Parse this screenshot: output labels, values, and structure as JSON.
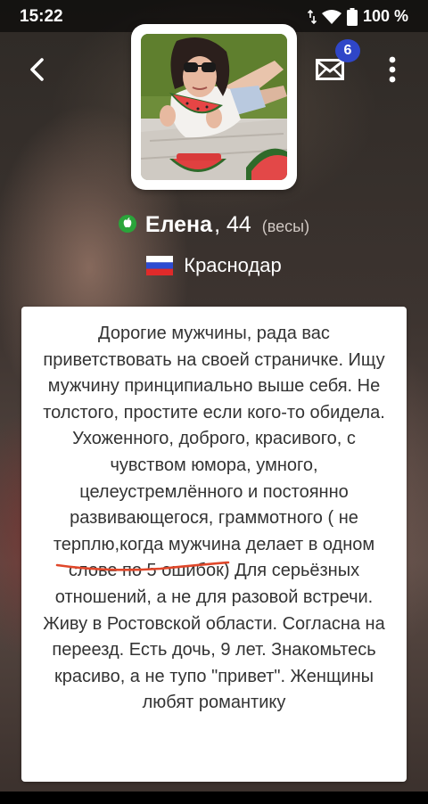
{
  "status_bar": {
    "time": "15:22",
    "battery": "100 %",
    "icons": [
      "data-arrows-icon",
      "wifi-icon",
      "battery-icon"
    ]
  },
  "header": {
    "back_icon": "chevron-left-icon",
    "messages_icon": "envelope-icon",
    "messages_badge": "6",
    "menu_icon": "more-vertical-icon"
  },
  "profile": {
    "online_icon": "apple-online-icon",
    "name": "Елена",
    "age": ", 44",
    "zodiac": "(весы)",
    "city": "Краснодар",
    "flag": "russia-flag",
    "online_color": "#2aa43a"
  },
  "about": {
    "text": "Дорогие мужчины, рада вас приветствовать на своей страничке. Ищу мужчину принципиально выше себя. Не толстого, простите если кого-то обидела. Ухоженного, доброго, красивого, с чувством юмора, умного, целеустремлённого и постоянно развивающегося, граммотного ( не терплю,когда мужчина делает в одном слове по 5 ошибок) Для серьёзных отношений, а не для разовой встречи. Живу в Ростовской области. Согласна на переезд. Есть дочь, 9 лет. Знакомьтесь красиво, а не тупо \"привет\". Женщины любят романтику",
    "highlight_color": "#e0472a"
  },
  "colors": {
    "badge": "#2f46c8",
    "card": "#ffffff",
    "text": "#333333"
  }
}
